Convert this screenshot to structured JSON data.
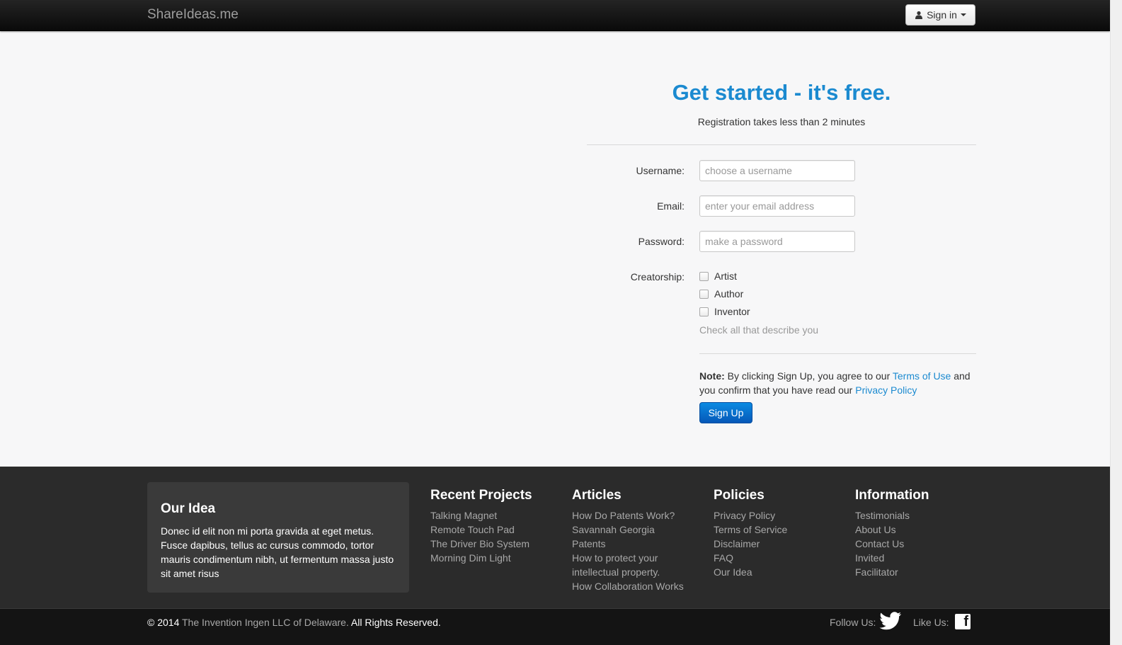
{
  "nav": {
    "brand": "ShareIdeas.me",
    "signin_label": "Sign in"
  },
  "hero": {
    "title": "Get started - it's free.",
    "subtitle": "Registration takes less than 2 minutes"
  },
  "form": {
    "username_label": "Username:",
    "username_placeholder": "choose a username",
    "email_label": "Email:",
    "email_placeholder": "enter your email address",
    "password_label": "Password:",
    "password_placeholder": "make a password",
    "creatorship_label": "Creatorship:",
    "options": [
      "Artist",
      "Author",
      "Inventor"
    ],
    "help_text": "Check all that describe you",
    "note_bold": "Note:",
    "note_text1": " By clicking Sign Up, you agree to our ",
    "terms_link": "Terms of Use",
    "note_text2": " and you confirm that you have read our ",
    "privacy_link": "Privacy Policy",
    "signup_label": "Sign Up"
  },
  "footer": {
    "idea_title": "Our Idea",
    "idea_text": "Donec id elit non mi porta gravida at eget metus. Fusce dapibus, tellus ac cursus commodo, tortor mauris condimentum nibh, ut fermentum massa justo sit amet risus",
    "columns": [
      {
        "title": "Recent Projects",
        "links": [
          "Talking Magnet",
          "Remote Touch Pad",
          "The Driver Bio System",
          "Morning Dim Light"
        ]
      },
      {
        "title": "Articles",
        "links": [
          "How Do Patents Work?",
          "Savannah Georgia",
          "Patents",
          "How to protect your",
          "intellectual property.",
          "How Collaboration Works"
        ]
      },
      {
        "title": "Policies",
        "links": [
          "Privacy Policy",
          "Terms of Service",
          "Disclaimer",
          "FAQ",
          "Our Idea"
        ]
      },
      {
        "title": "Information",
        "links": [
          "Testimonials",
          "About Us",
          "Contact Us",
          "Invited",
          "Facilitator"
        ]
      }
    ],
    "copyright_prefix": "© 2014 ",
    "company": "The Invention Ingen LLC of Delaware.",
    "rights": " All Rights Reserved.",
    "follow_label": "Follow Us:",
    "like_label": "Like Us:",
    "facebook_glyph": "f"
  }
}
